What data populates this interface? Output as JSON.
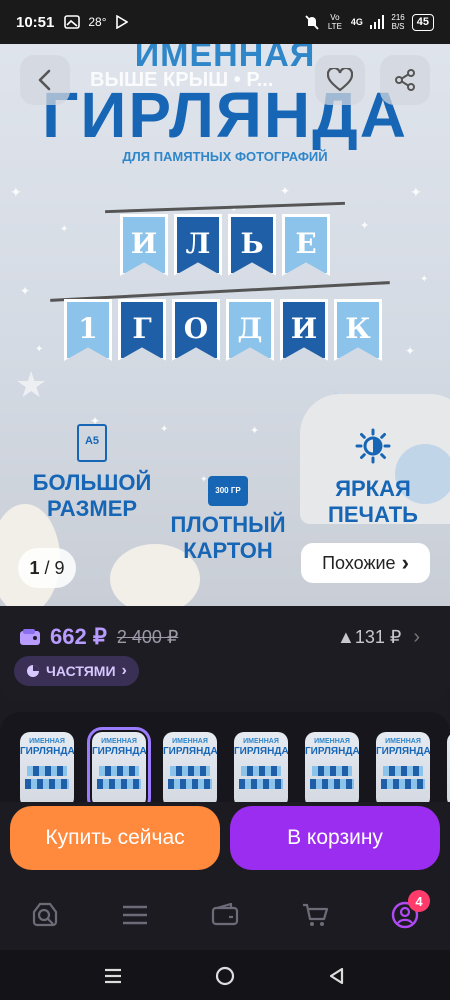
{
  "status_bar": {
    "time": "10:51",
    "temperature": "28°",
    "network_type": "Vo LTE",
    "signal": "4G",
    "net_speed_value": "216",
    "net_speed_unit": "B/S",
    "battery": "45"
  },
  "header": {
    "title": "ВЫШЕ КРЫШ • Р...",
    "back_icon": "chevron-left-icon",
    "favorite_icon": "heart-icon",
    "share_icon": "share-icon"
  },
  "hero": {
    "title_line1": "ИМЕННАЯ",
    "title_line2": "ГИРЛЯНДА",
    "subtitle": "ДЛЯ ПАМЯТНЫХ ФОТОГРАФИЙ",
    "garland_row1": [
      "И",
      "Л",
      "Ь",
      "Е"
    ],
    "garland_row2": [
      "1",
      "Г",
      "О",
      "Д",
      "И",
      "К"
    ],
    "feature_size_badge": "A5",
    "feature_size": [
      "БОЛЬШОЙ",
      "РАЗМЕР"
    ],
    "feature_density_badge": "300 ГР",
    "feature_density": [
      "ПЛОТНЫЙ",
      "КАРТОН"
    ],
    "feature_print": [
      "ЯРКАЯ",
      "ПЕЧАТЬ"
    ],
    "pager_current": "1",
    "pager_total": "/ 9",
    "similar_label": "Похожие",
    "similar_arrow": "›"
  },
  "pricing": {
    "price": "662 ₽",
    "old_price": "2 400 ₽",
    "delta": "▲131 ₽",
    "delta_arrow": "›",
    "installments_label": "ЧАСТЯМИ",
    "installments_arrow": "›"
  },
  "thumbnails": {
    "count": 7,
    "selected_index": 1,
    "title_line1": "ИМЕННАЯ",
    "title_line2": "ГИРЛЯНДА"
  },
  "actions": {
    "buy_now": "Купить сейчас",
    "add_to_cart": "В корзину"
  },
  "tabbar": {
    "items": [
      "search-icon",
      "menu-icon",
      "wallet-icon",
      "cart-icon",
      "profile-icon"
    ],
    "profile_badge": "4"
  },
  "colors": {
    "accent_purple": "#9b2df0",
    "accent_orange": "#ff8a3d",
    "price_purple": "#b89bff",
    "brand_blue": "#1766b5"
  }
}
